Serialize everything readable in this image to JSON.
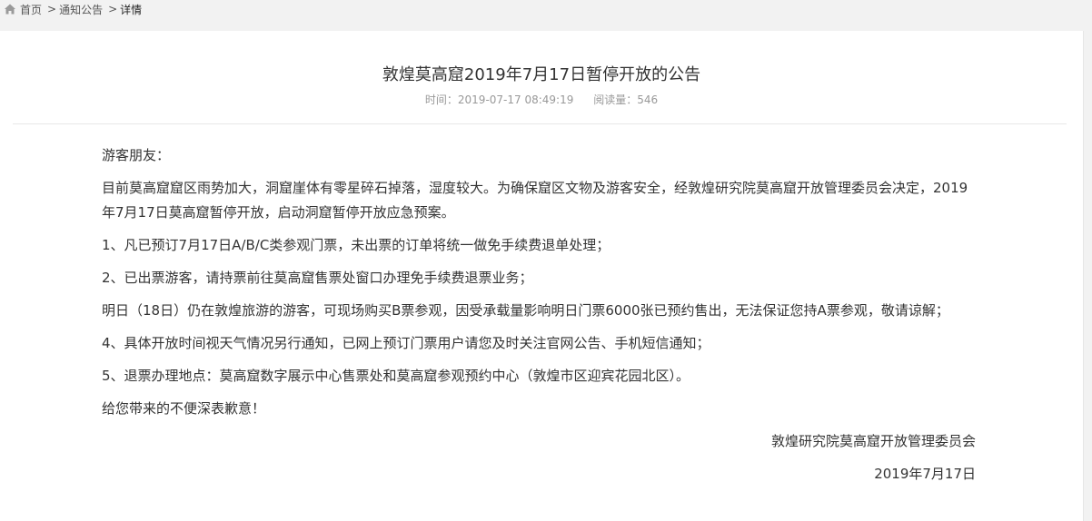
{
  "breadcrumb": {
    "home": "首页",
    "sep1": ">",
    "section": "通知公告",
    "sep2": ">",
    "current": "详情"
  },
  "article": {
    "title": "敦煌莫高窟2019年7月17日暂停开放的公告",
    "time_label": "时间：",
    "time_value": "2019-07-17 08:49:19",
    "reads_label": "阅读量：",
    "reads_value": "546",
    "greeting": "游客朋友：",
    "paragraphs": [
      "目前莫高窟窟区雨势加大，洞窟崖体有零星碎石掉落，湿度较大。为确保窟区文物及游客安全，经敦煌研究院莫高窟开放管理委员会决定，2019年7月17日莫高窟暂停开放，启动洞窟暂停开放应急预案。",
      "1、凡已预订7月17日A/B/C类参观门票，未出票的订单将统一做免手续费退单处理；",
      "2、已出票游客，请持票前往莫高窟售票处窗口办理免手续费退票业务；",
      "明日（18日）仍在敦煌旅游的游客，可现场购买B票参观，因受承载量影响明日门票6000张已预约售出，无法保证您持A票参观，敬请谅解；",
      "4、具体开放时间视天气情况另行通知，已网上预订门票用户请您及时关注官网公告、手机短信通知；",
      "5、退票办理地点：莫高窟数字展示中心售票处和莫高窟参观预约中心（敦煌市区迎宾花园北区）。",
      "给您带来的不便深表歉意！"
    ],
    "signature": "敦煌研究院莫高窟开放管理委员会",
    "date": "2019年7月17日"
  }
}
